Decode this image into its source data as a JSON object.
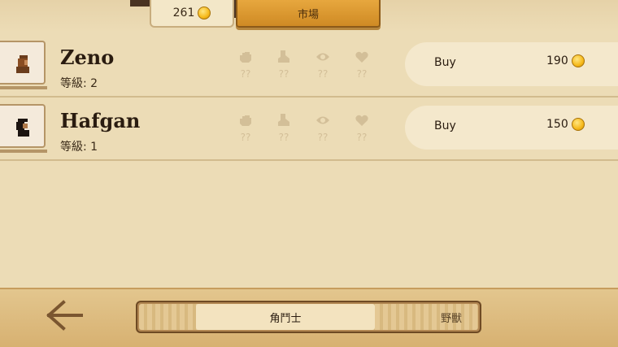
{
  "header": {
    "coins": "261",
    "market_tab": "市場"
  },
  "gladiators": [
    {
      "name": "Zeno",
      "level": "等級: 2",
      "price": "190",
      "buy_label": "Buy",
      "stats": [
        "??",
        "??",
        "??",
        "??"
      ]
    },
    {
      "name": "Hafgan",
      "level": "等級: 1",
      "price": "150",
      "buy_label": "Buy",
      "stats": [
        "??",
        "??",
        "??",
        "??"
      ]
    }
  ],
  "stat_icons": [
    "fist-icon",
    "boot-icon",
    "eye-icon",
    "heart-icon"
  ],
  "footer": {
    "tab_gladiators": "角鬥士",
    "tab_beasts": "野獸"
  },
  "colors": {
    "background": "#ecdcb6",
    "coin": "#f6b91a",
    "market_tab": "#e7a73e",
    "stat_icon": "#d3bf98"
  }
}
